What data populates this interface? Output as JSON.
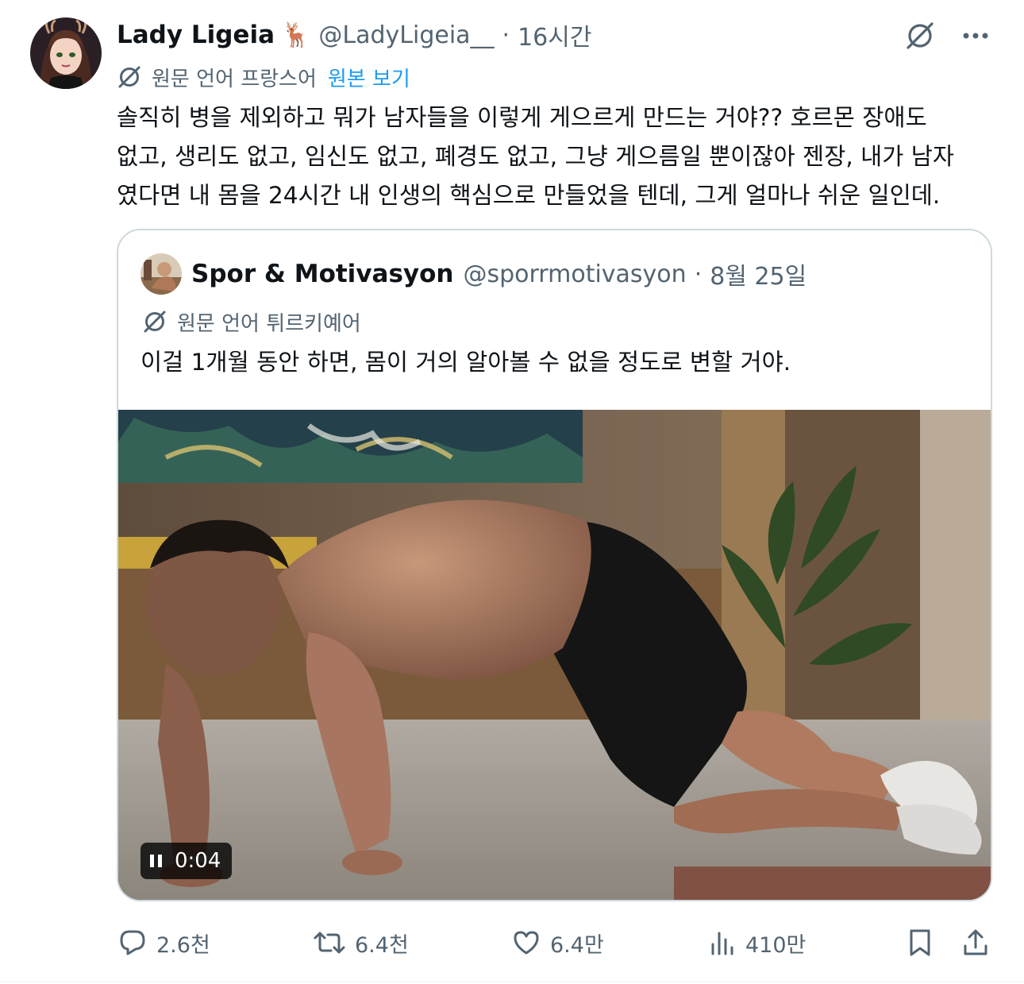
{
  "tweet": {
    "author": {
      "display_name": "Lady Ligeia",
      "emoji": "🦌",
      "handle": "@LadyLigeia__",
      "separator": "·",
      "time": "16시간"
    },
    "translation": {
      "label": "원문 언어 프랑스어",
      "view_original": "원본 보기"
    },
    "text_lines": [
      "솔직히 병을 제외하고 뭐가 남자들을 이렇게 게으르게 만드는 거야?? 호르몬 장애도",
      "없고, 생리도 없고, 임신도 없고, 폐경도 없고, 그냥 게으름일 뿐이잖아 젠장, 내가 남자",
      "였다면 내 몸을 24시간 내 인생의 핵심으로 만들었을 텐데, 그게 얼마나 쉬운 일인데."
    ],
    "icons": {
      "grok": "grok-slash-circle-icon",
      "more": "more-dots-icon",
      "translate": "translate-slash-circle-icon"
    }
  },
  "quote": {
    "display_name": "Spor & Motivasyon",
    "handle": "@sporrmotivasyon",
    "separator": "·",
    "date": "8월 25일",
    "translation_label": "원문 언어 튀르키예어",
    "text": "이걸 1개월 동안 하면, 몸이 거의 알아볼 수 없을 정도로 변할 거야.",
    "video": {
      "timer": "0:04",
      "state": "playing"
    }
  },
  "actions": {
    "reply_count": "2.6천",
    "retweet_count": "6.4천",
    "like_count": "6.4만",
    "views_count": "410만"
  },
  "colors": {
    "text": "#0f1419",
    "secondary": "#536471",
    "link": "#1d9bf0",
    "border": "#cfd9de"
  }
}
